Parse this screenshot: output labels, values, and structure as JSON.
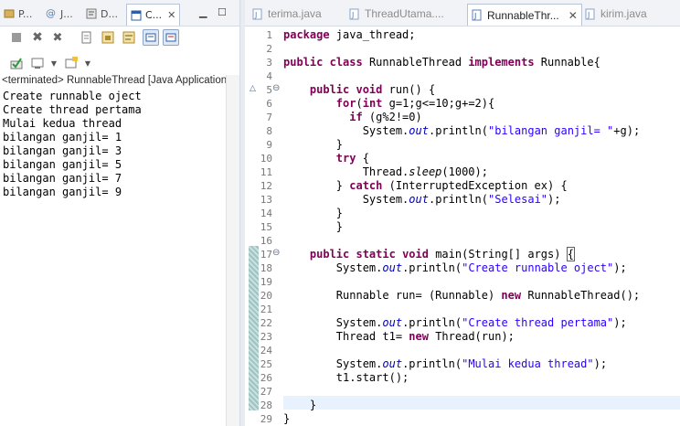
{
  "left_tabs": [
    {
      "label": "P...",
      "icon": "package-explorer-icon"
    },
    {
      "label": "J...",
      "icon": "javadoc-icon"
    },
    {
      "label": "D...",
      "icon": "declaration-icon"
    },
    {
      "label": "C...",
      "icon": "console-icon"
    }
  ],
  "left_tab_close": "✕",
  "console": {
    "status": "<terminated> RunnableThread [Java Application]",
    "lines": [
      "Create runnable oject",
      "Create thread pertama",
      "Mulai kedua thread",
      "bilangan ganjil= 1",
      "bilangan ganjil= 3",
      "bilangan ganjil= 5",
      "bilangan ganjil= 7",
      "bilangan ganjil= 9"
    ]
  },
  "editor_tabs": [
    {
      "label": "terima.java"
    },
    {
      "label": "ThreadUtama...."
    },
    {
      "label": "RunnableThr..."
    },
    {
      "label": "kirim.java"
    }
  ],
  "editor_tab_close": "✕",
  "line_numbers": [
    "1",
    "2",
    "3",
    "4",
    "5",
    "6",
    "7",
    "8",
    "9",
    "10",
    "11",
    "12",
    "13",
    "14",
    "15",
    "16",
    "17",
    "18",
    "19",
    "20",
    "21",
    "22",
    "23",
    "24",
    "25",
    "26",
    "27",
    "28",
    "29"
  ],
  "code": {
    "l1a": "package",
    "l1b": " java_thread;",
    "l3a": "public",
    "l3b": " ",
    "l3c": "class",
    "l3d": " RunnableThread ",
    "l3e": "implements",
    "l3f": " Runnable{",
    "l5a": "    public",
    "l5b": " ",
    "l5c": "void",
    "l5d": " run() {",
    "l6a": "        for",
    "l6b": "(",
    "l6c": "int",
    "l6d": " g=1;g<=10;g+=2){",
    "l7a": "          if",
    "l7b": " (g%2!=0)",
    "l8a": "            System.",
    "l8b": "out",
    "l8c": ".println(",
    "l8d": "\"bilangan ganjil= \"",
    "l8e": "+g);",
    "l9": "        }",
    "l10a": "        try",
    "l10b": " {",
    "l11a": "            Thread.",
    "l11b": "sleep",
    "l11c": "(1000);",
    "l12a": "        } ",
    "l12b": "catch",
    "l12c": " (InterruptedException ex) {",
    "l13a": "            System.",
    "l13b": "out",
    "l13c": ".println(",
    "l13d": "\"Selesai\"",
    "l13e": ");",
    "l14": "        }",
    "l15": "        }",
    "l17a": "    public",
    "l17b": " ",
    "l17c": "static",
    "l17d": " ",
    "l17e": "void",
    "l17f": " main(String[] args) ",
    "l17g": "{",
    "l18a": "        System.",
    "l18b": "out",
    "l18c": ".println(",
    "l18d": "\"Create runnable oject\"",
    "l18e": ");",
    "l20a": "        Runnable run= (Runnable) ",
    "l20b": "new",
    "l20c": " RunnableThread();",
    "l22a": "        System.",
    "l22b": "out",
    "l22c": ".println(",
    "l22d": "\"Create thread pertama\"",
    "l22e": ");",
    "l23a": "        Thread t1= ",
    "l23b": "new",
    "l23c": " Thread(run);",
    "l25a": "        System.",
    "l25b": "out",
    "l25c": ".println(",
    "l25d": "\"Mulai kedua thread\"",
    "l25e": ");",
    "l26": "        t1.start();",
    "l28": "    }",
    "l29": "}"
  },
  "colors": {
    "keyword": "#7f0055",
    "string": "#2a00ff",
    "field": "#0000c0"
  }
}
